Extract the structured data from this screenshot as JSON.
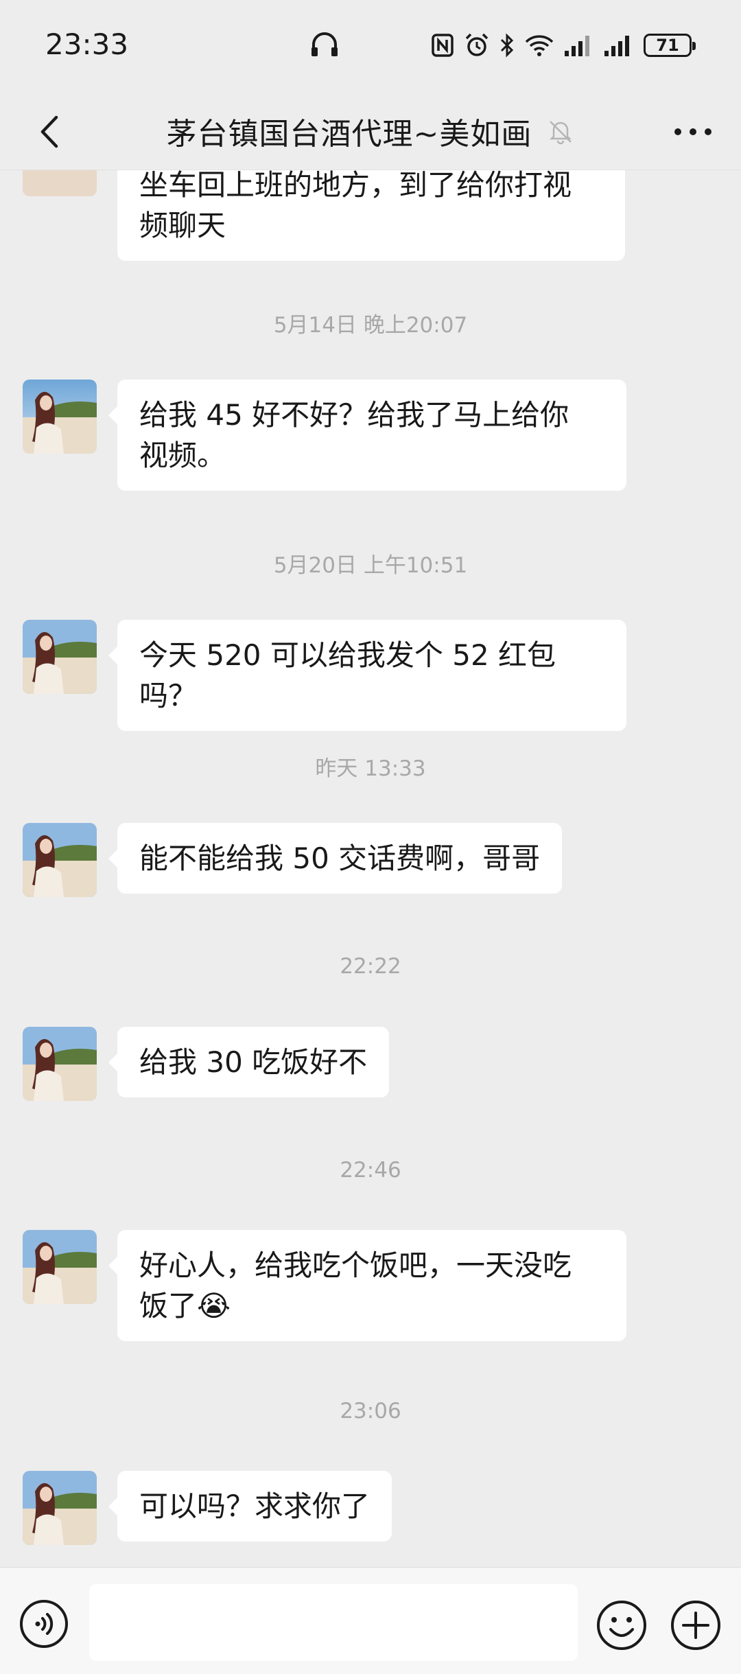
{
  "status": {
    "time": "23:33",
    "battery": "71"
  },
  "header": {
    "title": "茅台镇国台酒代理~美如画"
  },
  "messages": [
    {
      "type": "bubble",
      "lines": [
        "坐车回上班的地方，到了给你打视",
        "频聊天"
      ]
    },
    {
      "type": "time",
      "text": "5月14日 晚上20:07"
    },
    {
      "type": "bubble",
      "lines": [
        "给我 45 好不好？给我了马上给你",
        "视频。"
      ]
    },
    {
      "type": "time",
      "text": "5月20日 上午10:51"
    },
    {
      "type": "bubble",
      "lines": [
        "今天 520 可以给我发个 52 红包吗？"
      ]
    },
    {
      "type": "time",
      "text": "昨天 13:33"
    },
    {
      "type": "bubble",
      "lines": [
        "能不能给我 50 交话费啊，哥哥"
      ]
    },
    {
      "type": "time",
      "text": "22:22"
    },
    {
      "type": "bubble",
      "lines": [
        "给我 30 吃饭好不"
      ]
    },
    {
      "type": "time",
      "text": "22:46"
    },
    {
      "type": "bubble",
      "lines": [
        "好心人，给我吃个饭吧，一天没吃",
        "饭了😭"
      ]
    },
    {
      "type": "time",
      "text": "23:06"
    },
    {
      "type": "bubble",
      "lines": [
        "可以吗？求求你了"
      ]
    }
  ],
  "input": {
    "value": ""
  },
  "icons": {
    "back": "back-arrow-icon",
    "mute": "mute-bell-icon",
    "more": "more-dots-icon",
    "voice": "voice-icon",
    "emoji": "emoji-icon",
    "plus": "plus-icon"
  },
  "colors": {
    "background": "#ededed",
    "bubble": "#ffffff",
    "timestamp": "#a8a8a8"
  }
}
